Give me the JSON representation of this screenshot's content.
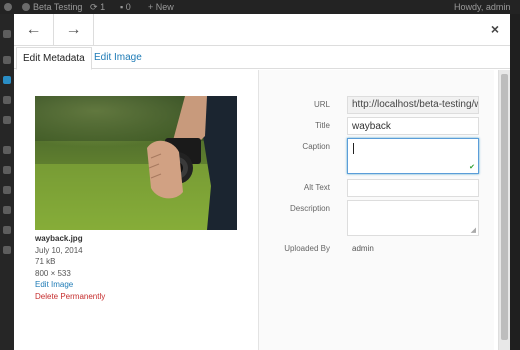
{
  "admin_bar": {
    "site_name": "Beta Testing",
    "updates_count": "1",
    "comments_count": "0",
    "new_label": "New",
    "greeting": "Howdy, admin"
  },
  "modal": {
    "close_glyph": "×",
    "prev_glyph": "←",
    "next_glyph": "→",
    "tabs": [
      {
        "label": "Edit Metadata",
        "active": true
      },
      {
        "label": "Edit Image",
        "active": false
      }
    ]
  },
  "attachment": {
    "filename": "wayback.jpg",
    "date": "July 10, 2014",
    "size": "71 kB",
    "dimensions": "800 × 533",
    "edit_image_link": "Edit Image",
    "delete_link": "Delete Permanently"
  },
  "fields": {
    "url_label": "URL",
    "url_value": "http://localhost/beta-testing/w",
    "title_label": "Title",
    "title_value": "wayback",
    "caption_label": "Caption",
    "caption_value": "",
    "alt_label": "Alt Text",
    "alt_value": "",
    "description_label": "Description",
    "description_value": "",
    "uploaded_by_label": "Uploaded By",
    "uploaded_by_value": "admin"
  },
  "icons": {
    "prev": "arrow-left-icon",
    "next": "arrow-right-icon",
    "close": "close-icon",
    "spellcheck": "spellcheck-icon",
    "resize": "resize-handle-icon"
  },
  "colors": {
    "link": "#1e7bb6",
    "danger": "#c62e2e",
    "focus": "#5b9dd9"
  }
}
